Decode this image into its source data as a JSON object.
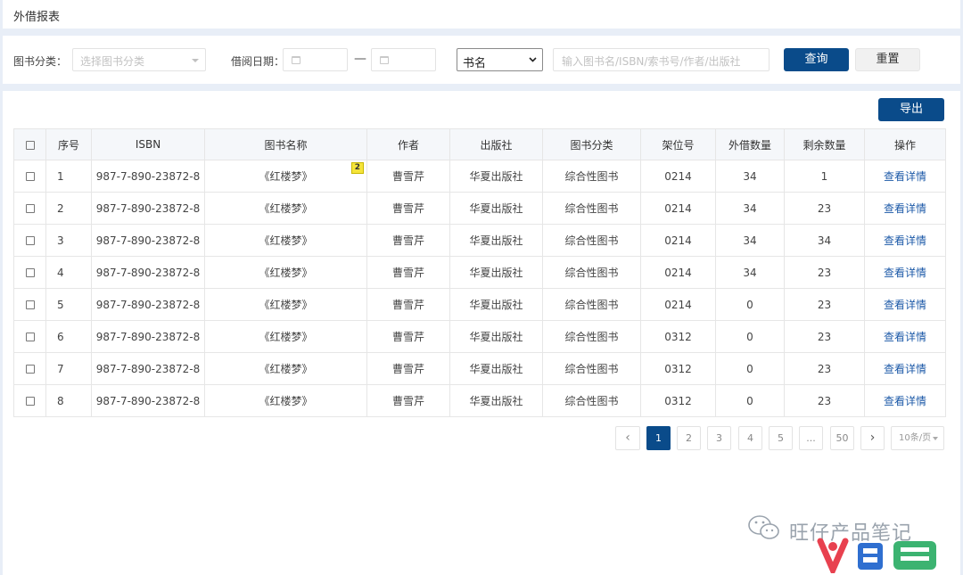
{
  "page_title": "外借报表",
  "filters": {
    "category_label": "图书分类：",
    "category_placeholder": "选择图书分类",
    "date_label": "借阅日期：",
    "date_separator": "—",
    "search_field_selected": "书名",
    "search_placeholder": "输入图书名/ISBN/索书号/作者/出版社",
    "query_button": "查询",
    "reset_button": "重置"
  },
  "export_button": "导出",
  "table": {
    "headers": [
      "序号",
      "ISBN",
      "图书名称",
      "作者",
      "出版社",
      "图书分类",
      "架位号",
      "外借数量",
      "剩余数量",
      "操作"
    ],
    "rows": [
      {
        "no": "1",
        "isbn": "987-7-890-23872-8",
        "title": "《红楼梦》",
        "author": "曹雪芹",
        "publisher": "华夏出版社",
        "category": "综合性图书",
        "shelf": "0214",
        "lent": "34",
        "remain": "1",
        "action": "查看详情"
      },
      {
        "no": "2",
        "isbn": "987-7-890-23872-8",
        "title": "《红楼梦》",
        "author": "曹雪芹",
        "publisher": "华夏出版社",
        "category": "综合性图书",
        "shelf": "0214",
        "lent": "34",
        "remain": "23",
        "action": "查看详情"
      },
      {
        "no": "3",
        "isbn": "987-7-890-23872-8",
        "title": "《红楼梦》",
        "author": "曹雪芹",
        "publisher": "华夏出版社",
        "category": "综合性图书",
        "shelf": "0214",
        "lent": "34",
        "remain": "34",
        "action": "查看详情"
      },
      {
        "no": "4",
        "isbn": "987-7-890-23872-8",
        "title": "《红楼梦》",
        "author": "曹雪芹",
        "publisher": "华夏出版社",
        "category": "综合性图书",
        "shelf": "0214",
        "lent": "34",
        "remain": "23",
        "action": "查看详情"
      },
      {
        "no": "5",
        "isbn": "987-7-890-23872-8",
        "title": "《红楼梦》",
        "author": "曹雪芹",
        "publisher": "华夏出版社",
        "category": "综合性图书",
        "shelf": "0214",
        "lent": "0",
        "remain": "23",
        "action": "查看详情"
      },
      {
        "no": "6",
        "isbn": "987-7-890-23872-8",
        "title": "《红楼梦》",
        "author": "曹雪芹",
        "publisher": "华夏出版社",
        "category": "综合性图书",
        "shelf": "0312",
        "lent": "0",
        "remain": "23",
        "action": "查看详情"
      },
      {
        "no": "7",
        "isbn": "987-7-890-23872-8",
        "title": "《红楼梦》",
        "author": "曹雪芹",
        "publisher": "华夏出版社",
        "category": "综合性图书",
        "shelf": "0312",
        "lent": "0",
        "remain": "23",
        "action": "查看详情"
      },
      {
        "no": "8",
        "isbn": "987-7-890-23872-8",
        "title": "《红楼梦》",
        "author": "曹雪芹",
        "publisher": "华夏出版社",
        "category": "综合性图书",
        "shelf": "0312",
        "lent": "0",
        "remain": "23",
        "action": "查看详情"
      }
    ],
    "annotation_badge": "2"
  },
  "pagination": {
    "prev": "‹",
    "pages": [
      "1",
      "2",
      "3",
      "4",
      "5",
      "...",
      "50"
    ],
    "current": "1",
    "next": "›",
    "page_size": "10条/页"
  },
  "watermark": {
    "text": "旺仔产品笔记",
    "logo": "人人都是产品经理"
  },
  "colors": {
    "primary": "#0a4b8a",
    "link": "#1d5aa8",
    "page_bg": "#e8eef7",
    "badge": "#f5e43a"
  }
}
